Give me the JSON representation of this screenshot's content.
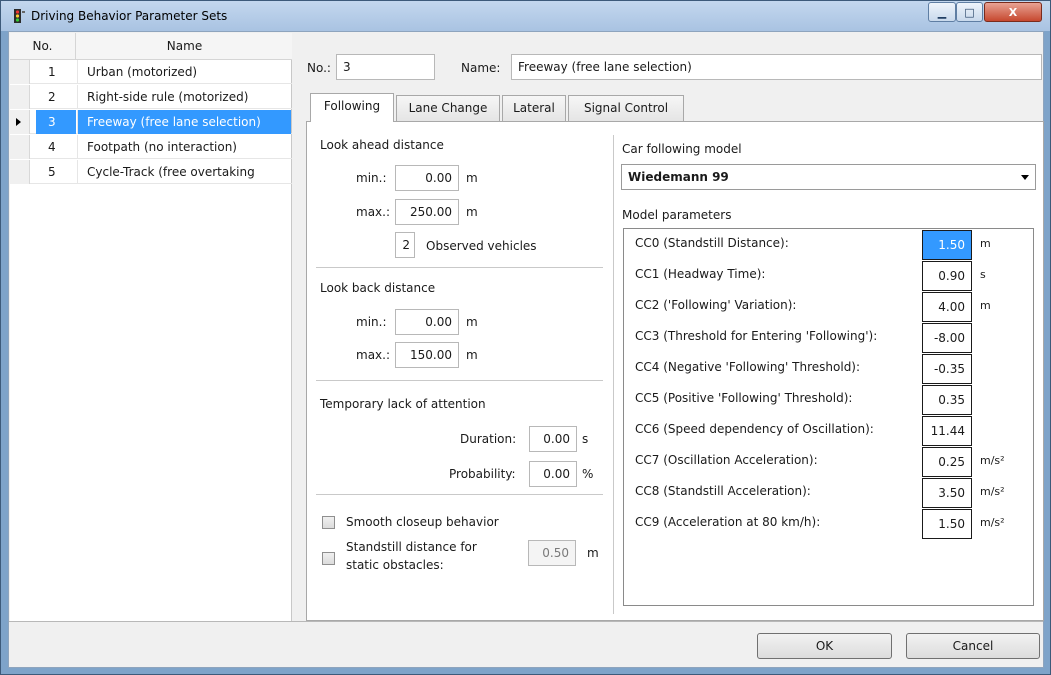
{
  "window": {
    "title": "Driving Behavior Parameter Sets",
    "min_glyph": "▁",
    "max_glyph": "□",
    "close_glyph": "X"
  },
  "list": {
    "headers": {
      "no": "No.",
      "name": "Name"
    },
    "rows": [
      {
        "no": "1",
        "name": "Urban (motorized)"
      },
      {
        "no": "2",
        "name": "Right-side rule (motorized)"
      },
      {
        "no": "3",
        "name": "Freeway (free lane selection)"
      },
      {
        "no": "4",
        "name": "Footpath (no interaction)"
      },
      {
        "no": "5",
        "name": "Cycle-Track (free overtaking"
      }
    ],
    "selected_index": 2
  },
  "header": {
    "no_label": "No.:",
    "no_value": "3",
    "name_label": "Name:",
    "name_value": "Freeway (free lane selection)"
  },
  "tabs": [
    "Following",
    "Lane Change",
    "Lateral",
    "Signal Control"
  ],
  "following": {
    "look_ahead": {
      "title": "Look ahead distance",
      "min_label": "min.:",
      "min_value": "0.00",
      "min_unit": "m",
      "max_label": "max.:",
      "max_value": "250.00",
      "max_unit": "m",
      "observed_value": "2",
      "observed_label": "Observed vehicles"
    },
    "look_back": {
      "title": "Look back distance",
      "min_label": "min.:",
      "min_value": "0.00",
      "min_unit": "m",
      "max_label": "max.:",
      "max_value": "150.00",
      "max_unit": "m"
    },
    "attention": {
      "title": "Temporary lack of attention",
      "duration_label": "Duration:",
      "duration_value": "0.00",
      "duration_unit": "s",
      "probability_label": "Probability:",
      "probability_value": "0.00",
      "probability_unit": "%"
    },
    "smooth_closeup_label": "Smooth closeup behavior",
    "smooth_closeup_checked": false,
    "standstill_label_line1": "Standstill distance for",
    "standstill_label_line2": "static obstacles:",
    "standstill_checked": false,
    "standstill_value": "0.50",
    "standstill_unit": "m",
    "model": {
      "title": "Car following model",
      "selected": "Wiedemann 99",
      "params_title": "Model parameters",
      "params": [
        {
          "label": "CC0 (Standstill Distance):",
          "value": "1.50",
          "unit": "m"
        },
        {
          "label": "CC1 (Headway Time):",
          "value": "0.90",
          "unit": "s"
        },
        {
          "label": "CC2 ('Following' Variation):",
          "value": "4.00",
          "unit": "m"
        },
        {
          "label": "CC3 (Threshold for Entering 'Following'):",
          "value": "-8.00",
          "unit": ""
        },
        {
          "label": "CC4 (Negative 'Following' Threshold):",
          "value": "-0.35",
          "unit": ""
        },
        {
          "label": "CC5 (Positive 'Following' Threshold):",
          "value": "0.35",
          "unit": ""
        },
        {
          "label": "CC6 (Speed dependency of Oscillation):",
          "value": "11.44",
          "unit": ""
        },
        {
          "label": "CC7 (Oscillation Acceleration):",
          "value": "0.25",
          "unit": "m/s²"
        },
        {
          "label": "CC8 (Standstill Acceleration):",
          "value": "3.50",
          "unit": "m/s²"
        },
        {
          "label": "CC9 (Acceleration at 80 km/h):",
          "value": "1.50",
          "unit": "m/s²"
        }
      ]
    }
  },
  "buttons": {
    "ok": "OK",
    "cancel": "Cancel"
  },
  "colors": {
    "selection": "#3399ff",
    "titlebar": "#b8cfe9"
  }
}
